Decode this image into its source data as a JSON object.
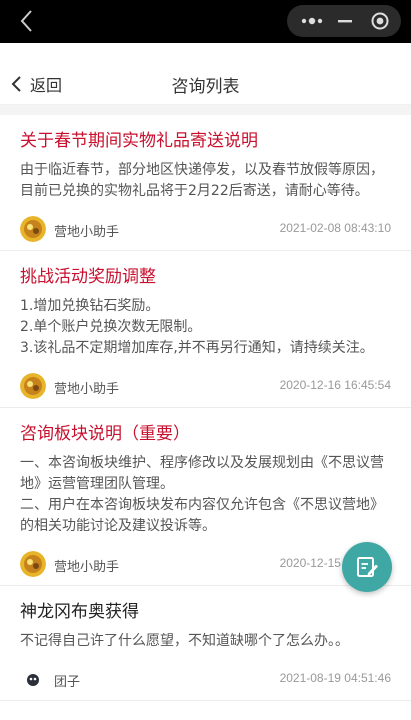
{
  "header": {
    "back_label": "返回",
    "title": "咨询列表"
  },
  "posts": [
    {
      "title": "关于春节期间实物礼品寄送说明",
      "body": "由于临近春节，部分地区快递停发，以及春节放假等原因，目前已兑换的实物礼品将于2月22后寄送，请耐心等待。",
      "author": "营地小助手",
      "time": "2021-02-08 08:43:10"
    },
    {
      "title": "挑战活动奖励调整",
      "body": "1.增加兑换钻石奖励。\n2.单个账户兑换次数无限制。\n3.该礼品不定期增加库存,并不再另行通知，请持续关注。",
      "author": "营地小助手",
      "time": "2020-12-16 16:45:54"
    },
    {
      "title": "咨询板块说明（重要）",
      "body": "一、本咨询板块维护、程序修改以及发展规划由《不思议营地》运营管理团队管理。\n二、用户在本咨询板块发布内容仅允许包含《不思议营地》的相关功能讨论及建议投诉等。",
      "author": "营地小助手",
      "time": "2020-12-15 16:43:12"
    },
    {
      "title": "神龙冈布奥获得",
      "body": "不记得自己许了什么愿望，不知道缺哪个了怎么办。。",
      "author": "团子",
      "time": "2021-08-19 04:51:46"
    }
  ],
  "colors": {
    "title_red": "#c8102e",
    "fab": "#3fa8a4"
  },
  "icons": {
    "fab": "edit-note-icon",
    "avatar_official": "gold-mascot-avatar",
    "avatar_user": "dark-mascot-avatar"
  }
}
